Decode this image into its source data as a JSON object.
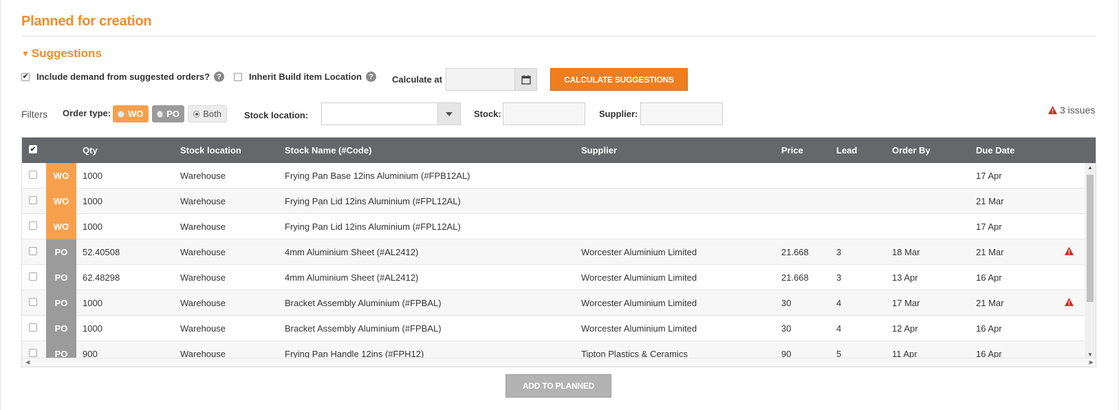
{
  "page": {
    "title": "Planned for creation"
  },
  "suggestions": {
    "header": "Suggestions",
    "include_demand_label": "Include demand from suggested orders?",
    "include_demand_checked": true,
    "inherit_label": "Inherit Build item Location",
    "inherit_checked": false,
    "calculate_at_label": "Calculate at",
    "calculate_at_value": "",
    "calculate_button": "CALCULATE SUGGESTIONS"
  },
  "filters": {
    "label": "Filters",
    "order_type_label": "Order type:",
    "order_types": [
      "WO",
      "PO",
      "Both"
    ],
    "order_type_selected": "Both",
    "stock_location_label": "Stock location:",
    "stock_label": "Stock:",
    "supplier_label": "Supplier:",
    "issues": "3 issues"
  },
  "grid": {
    "columns": [
      "Qty",
      "Stock location",
      "Stock Name (#Code)",
      "Supplier",
      "Price",
      "Lead",
      "Order By",
      "Due Date"
    ],
    "rows": [
      {
        "type": "WO",
        "qty": "1000",
        "location": "Warehouse",
        "name": "Frying Pan Base 12ins Aluminium (#FPB12AL)",
        "supplier": "",
        "price": "",
        "lead": "",
        "order_by": "",
        "due": "17 Apr",
        "warn": false
      },
      {
        "type": "WO",
        "qty": "1000",
        "location": "Warehouse",
        "name": "Frying Pan Lid 12ins Aluminium (#FPL12AL)",
        "supplier": "",
        "price": "",
        "lead": "",
        "order_by": "",
        "due": "21 Mar",
        "warn": false
      },
      {
        "type": "WO",
        "qty": "1000",
        "location": "Warehouse",
        "name": "Frying Pan Lid 12ins Aluminium (#FPL12AL)",
        "supplier": "",
        "price": "",
        "lead": "",
        "order_by": "",
        "due": "17 Apr",
        "warn": false
      },
      {
        "type": "PO",
        "qty": "52.40508",
        "location": "Warehouse",
        "name": "4mm Aluminium Sheet (#AL2412)",
        "supplier": "Worcester Aluminium Limited",
        "price": "21.668",
        "lead": "3",
        "order_by": "18 Mar",
        "due": "21 Mar",
        "warn": true
      },
      {
        "type": "PO",
        "qty": "62.48298",
        "location": "Warehouse",
        "name": "4mm Aluminium Sheet (#AL2412)",
        "supplier": "Worcester Aluminium Limited",
        "price": "21.668",
        "lead": "3",
        "order_by": "13 Apr",
        "due": "16 Apr",
        "warn": false
      },
      {
        "type": "PO",
        "qty": "1000",
        "location": "Warehouse",
        "name": "Bracket Assembly Aluminium (#FPBAL)",
        "supplier": "Worcester Aluminium Limited",
        "price": "30",
        "lead": "4",
        "order_by": "17 Mar",
        "due": "21 Mar",
        "warn": true
      },
      {
        "type": "PO",
        "qty": "1000",
        "location": "Warehouse",
        "name": "Bracket Assembly Aluminium (#FPBAL)",
        "supplier": "Worcester Aluminium Limited",
        "price": "30",
        "lead": "4",
        "order_by": "12 Apr",
        "due": "16 Apr",
        "warn": false
      },
      {
        "type": "PO",
        "qty": "900",
        "location": "Warehouse",
        "name": "Frying Pan Handle 12ins (#FPH12)",
        "supplier": "Tipton Plastics & Ceramics",
        "price": "90",
        "lead": "5",
        "order_by": "11 Apr",
        "due": "16 Apr",
        "warn": false
      }
    ]
  },
  "add_button": "ADD TO PLANNED",
  "colors": {
    "accent": "#f28c28",
    "wo": "#f6a04d",
    "po": "#9b9b9b",
    "header": "#65676b",
    "warning": "#d9261c"
  }
}
